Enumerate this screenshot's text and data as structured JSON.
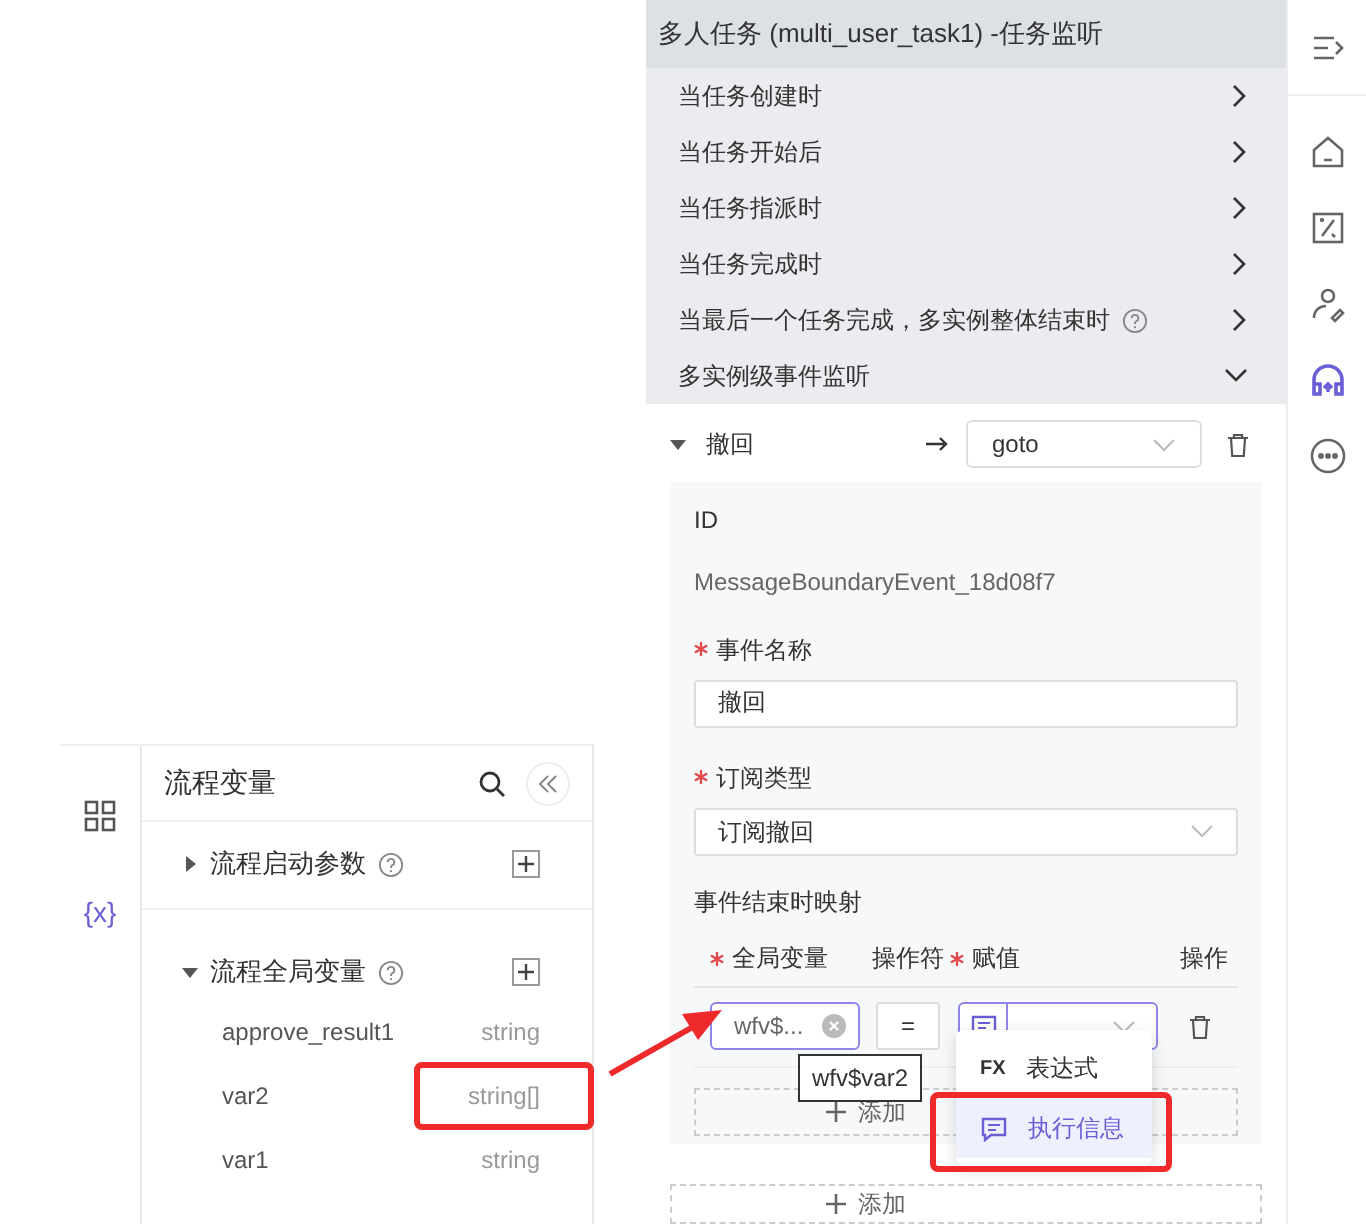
{
  "listener_panel": {
    "title": "多人任务 (multi_user_task1) -任务监听",
    "sections": [
      {
        "label": "当任务创建时",
        "expanded": false,
        "help": false
      },
      {
        "label": "当任务开始后",
        "expanded": false,
        "help": false
      },
      {
        "label": "当任务指派时",
        "expanded": false,
        "help": false
      },
      {
        "label": "当任务完成时",
        "expanded": false,
        "help": false
      },
      {
        "label": "当最后一个任务完成，多实例整体结束时",
        "expanded": false,
        "help": true
      },
      {
        "label": "多实例级事件监听",
        "expanded": true,
        "help": false
      }
    ]
  },
  "event": {
    "name": "撤回",
    "expanded": true,
    "action": "goto",
    "id_label": "ID",
    "id_value": "MessageBoundaryEvent_18d08f7",
    "fields": [
      {
        "label": "事件名称",
        "required": true,
        "kind": "input",
        "value": "撤回"
      },
      {
        "label": "订阅类型",
        "required": true,
        "kind": "select",
        "value": "订阅撤回"
      }
    ],
    "mapping": {
      "title": "事件结束时映射",
      "columns": [
        {
          "label": "全局变量",
          "required": true
        },
        {
          "label": "操作符",
          "required": false
        },
        {
          "label": "赋值",
          "required": true
        },
        {
          "label": "操作",
          "required": false
        }
      ],
      "rows": [
        {
          "variable": "wfv$...",
          "operator": "=",
          "tooltip": "wfv$var2"
        }
      ],
      "add_label": "添加"
    }
  },
  "add_label": "添加",
  "value_menu": [
    {
      "kind": "text",
      "icon_text": "FX",
      "label": "表达式",
      "selected": false
    },
    {
      "kind": "message",
      "label": "执行信息",
      "selected": true
    }
  ],
  "variables_panel": {
    "title": "流程变量",
    "groups": [
      {
        "label": "流程启动参数",
        "expanded": false
      },
      {
        "label": "流程全局变量",
        "expanded": true,
        "children": [
          {
            "name": "approve_result1",
            "type": "string"
          },
          {
            "name": "var2",
            "type": "string[]"
          },
          {
            "name": "var1",
            "type": "string"
          }
        ]
      }
    ]
  },
  "side_tabs": [
    {
      "kind": "grid",
      "selected": false
    },
    {
      "kind": "variable",
      "label": "{x}",
      "selected": true
    }
  ],
  "right_toolbar": [
    {
      "kind": "collapse",
      "selected": false
    },
    {
      "kind": "home",
      "selected": false
    },
    {
      "kind": "percent",
      "selected": false
    },
    {
      "kind": "user-edit",
      "selected": false
    },
    {
      "kind": "headset",
      "selected": true
    },
    {
      "kind": "more",
      "selected": false
    }
  ]
}
